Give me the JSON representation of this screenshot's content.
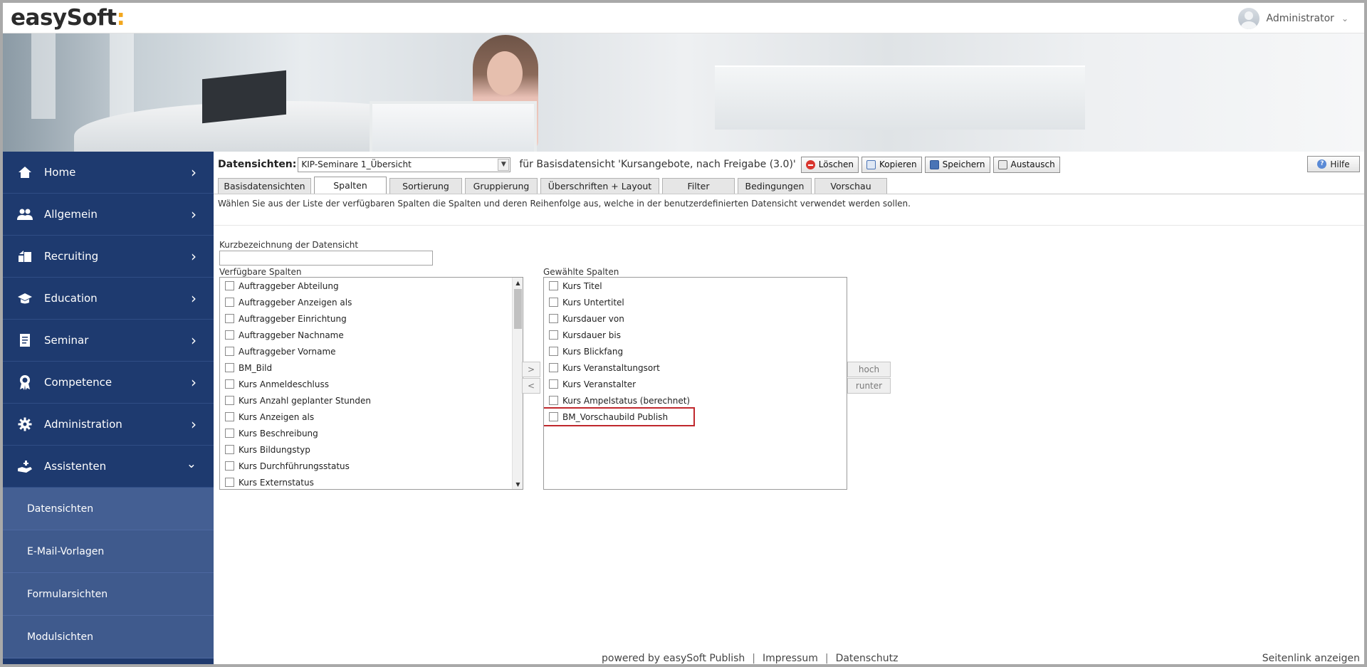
{
  "header": {
    "logo_text": "easySoft",
    "logo_accent": ":",
    "user_name": "Administrator",
    "user_menu_icon": "chevron-down-icon"
  },
  "sidebar": {
    "items": [
      {
        "label": "Home",
        "icon": "home-icon"
      },
      {
        "label": "Allgemein",
        "icon": "users-icon"
      },
      {
        "label": "Recruiting",
        "icon": "recruiting-icon"
      },
      {
        "label": "Education",
        "icon": "education-icon"
      },
      {
        "label": "Seminar",
        "icon": "document-icon"
      },
      {
        "label": "Competence",
        "icon": "award-icon"
      },
      {
        "label": "Administration",
        "icon": "gear-icon"
      },
      {
        "label": "Assistenten",
        "icon": "assistant-icon",
        "expanded": true
      }
    ],
    "subitems": [
      {
        "label": "Datensichten",
        "active": true
      },
      {
        "label": "E-Mail-Vorlagen"
      },
      {
        "label": "Formularsichten"
      },
      {
        "label": "Modulsichten"
      }
    ]
  },
  "toolbar": {
    "label": "Datensichten:",
    "selected_view": "KIP-Seminare 1_Übersicht",
    "description": "für Basisdatensicht 'Kursangebote, nach Freigabe (3.0)'",
    "delete_label": "Löschen",
    "copy_label": "Kopieren",
    "save_label": "Speichern",
    "exchange_label": "Austausch",
    "help_label": "Hilfe"
  },
  "tabs": [
    {
      "label": "Basisdatensichten"
    },
    {
      "label": "Spalten",
      "active": true
    },
    {
      "label": "Sortierung"
    },
    {
      "label": "Gruppierung"
    },
    {
      "label": "Überschriften + Layout"
    },
    {
      "label": "Filter"
    },
    {
      "label": "Bedingungen"
    },
    {
      "label": "Vorschau"
    }
  ],
  "intro_text": "Wählen Sie aus der Liste der verfügbaren Spalten die Spalten und deren Reihenfolge aus, welche in der benutzerdefinierten Datensicht verwendet werden sollen.",
  "short_name": {
    "label": "Kurzbezeichnung der Datensicht",
    "value": ""
  },
  "available": {
    "label": "Verfügbare Spalten",
    "items": [
      "Auftraggeber Abteilung",
      "Auftraggeber Anzeigen als",
      "Auftraggeber Einrichtung",
      "Auftraggeber Nachname",
      "Auftraggeber Vorname",
      "BM_Bild",
      "Kurs Anmeldeschluss",
      "Kurs Anzahl geplanter Stunden",
      "Kurs Anzeigen als",
      "Kurs Beschreibung",
      "Kurs Bildungstyp",
      "Kurs Durchführungsstatus",
      "Kurs Externstatus"
    ]
  },
  "selected": {
    "label": "Gewählte Spalten",
    "items": [
      "Kurs Titel",
      "Kurs Untertitel",
      "Kursdauer von",
      "Kursdauer bis",
      "Kurs Blickfang",
      "Kurs Veranstaltungsort",
      "Kurs Veranstalter",
      "Kurs Ampelstatus (berechnet)",
      "BM_Vorschaubild Publish"
    ],
    "highlighted_index": 8
  },
  "move_buttons": {
    "add": ">",
    "remove": "<"
  },
  "order_buttons": {
    "up": "hoch",
    "down": "runter"
  },
  "footer": {
    "powered": "powered by easySoft Publish",
    "separator": "|",
    "imprint": "Impressum",
    "privacy": "Datenschutz",
    "pagelink": "Seitenlink anzeigen"
  },
  "colors": {
    "sidebar": "#1f3a6e",
    "subnav": "#3f5a8d",
    "logo_accent": "#f2a71e",
    "highlight": "#c0282d"
  }
}
